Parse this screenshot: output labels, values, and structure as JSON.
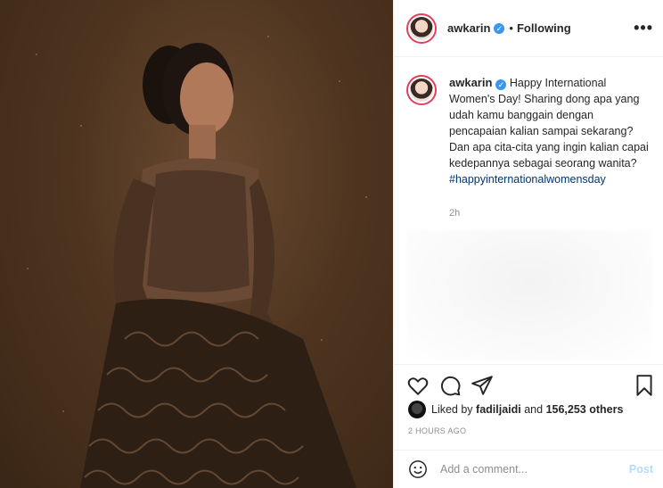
{
  "post": {
    "username": "awkarin",
    "follow_status": "Following",
    "separator": "•",
    "more_icon": "•••",
    "caption": "Happy International Women's Day! Sharing dong apa yang udah kamu banggain dengan pencapaian kalian sampai sekarang? Dan apa cita-cita yang ingin kalian capai kedepannya sebagai seorang wanita?",
    "hashtag": "#happyinternationalwomensday",
    "caption_time": "2h",
    "liked_by_prefix": "Liked by",
    "liked_by_user": "fadiljaidi",
    "liked_by_and": "and",
    "likes_others": "156,253 others",
    "posted_ago": "2 HOURS AGO",
    "comment_placeholder": "Add a comment...",
    "post_label": "Post",
    "verified_mark": "✓"
  },
  "colors": {
    "story_ring": "#e33e5c",
    "verified": "#3897f0",
    "hashtag": "#00376b",
    "post_disabled": "#b3dbff",
    "muted": "#8e8e8e"
  },
  "icons": [
    "more-icon",
    "verified-badge-icon",
    "heart-icon",
    "comment-icon",
    "share-icon",
    "bookmark-icon",
    "emoji-icon"
  ]
}
